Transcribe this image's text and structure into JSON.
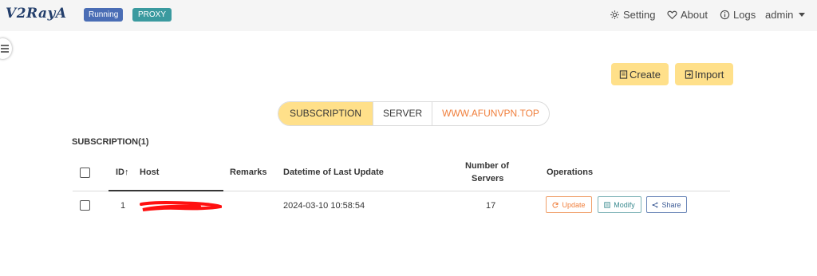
{
  "navbar": {
    "logo": "V2RayA",
    "status_tag": "Running",
    "mode_tag": "PROXY",
    "setting": "Setting",
    "about": "About",
    "logs": "Logs",
    "user": "admin"
  },
  "actions": {
    "create": "Create",
    "import": "Import"
  },
  "tabs": [
    {
      "label": "SUBSCRIPTION"
    },
    {
      "label": "SERVER"
    },
    {
      "label": "WWW.AFUNVPN.TOP"
    }
  ],
  "section_title": "SUBSCRIPTION(1)",
  "table": {
    "headers": {
      "id": "ID",
      "host": "Host",
      "remarks": "Remarks",
      "datetime": "Datetime of Last Update",
      "servers_1": "Number of",
      "servers_2": "Servers",
      "operations": "Operations"
    },
    "rows": [
      {
        "id": "1",
        "host": "",
        "remarks": "",
        "datetime": "2024-03-10 10:58:54",
        "servers": "17"
      }
    ],
    "ops": {
      "update": "Update",
      "modify": "Modify",
      "share": "Share"
    }
  },
  "colors": {
    "warning": "#ffe08a",
    "accent_orange": "#f07f3c",
    "running": "#4a6db5",
    "proxy": "#3a9a9f"
  }
}
